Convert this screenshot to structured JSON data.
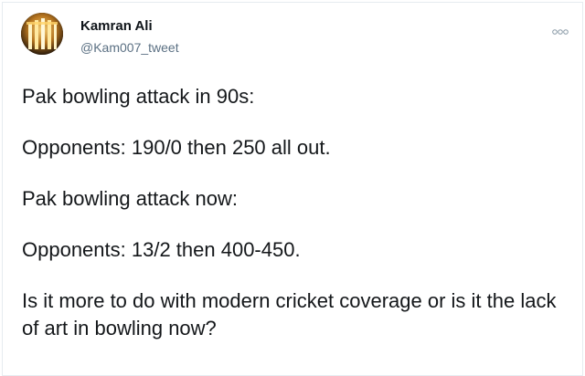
{
  "tweet": {
    "author": {
      "name": "Kamran Ali",
      "handle": "@Kam007_tweet",
      "avatar_icon": "stadium-lights-avatar"
    },
    "more_icon": "more-dots-icon",
    "lines": [
      "Pak bowling attack in 90s:",
      "Opponents: 190/0 then 250 all out.",
      "Pak bowling attack now:",
      "Opponents: 13/2 then 400-450.",
      "Is it more to do with modern cricket coverage or is it the lack of art in bowling now?"
    ]
  },
  "colors": {
    "text": "#14171a",
    "secondary": "#5b7083",
    "border": "#e6ecf0"
  }
}
